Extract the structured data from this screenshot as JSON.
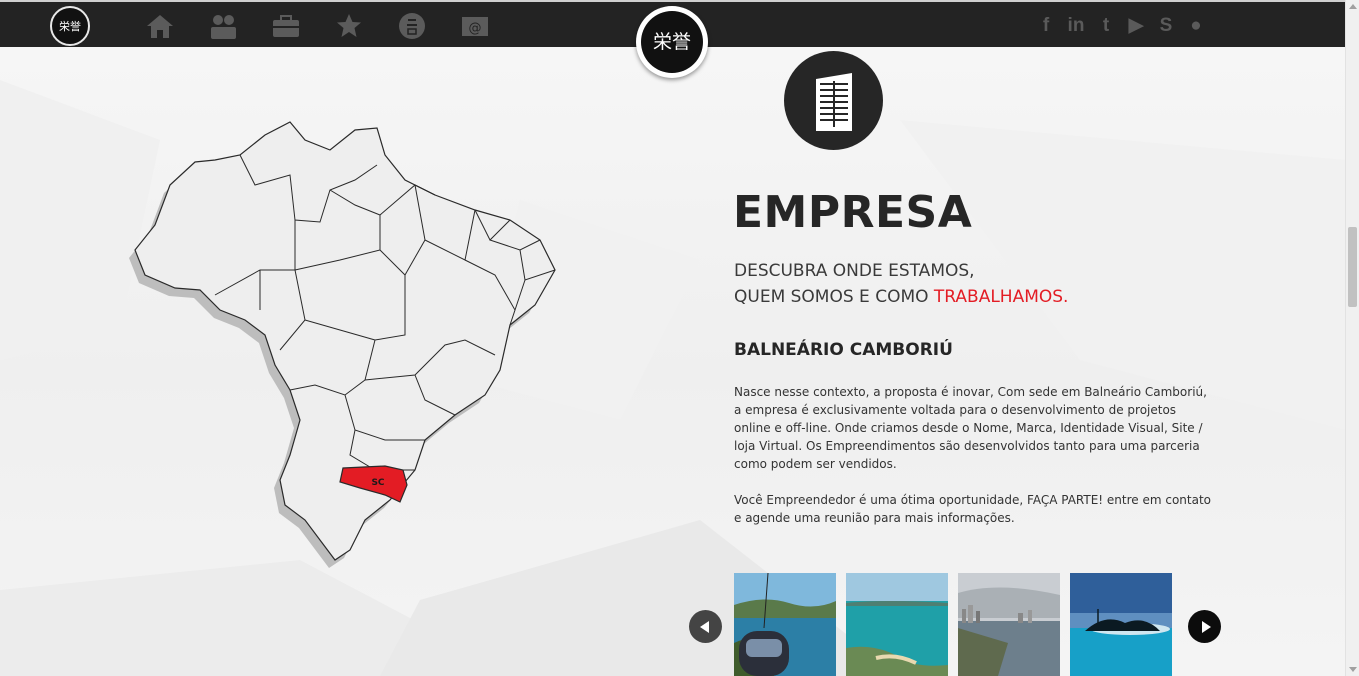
{
  "nav": {
    "logo_small_text": "栄誉",
    "items": [
      {
        "icon": "home-icon"
      },
      {
        "icon": "people-icon"
      },
      {
        "icon": "briefcase-icon"
      },
      {
        "icon": "star-icon"
      },
      {
        "icon": "kanji-badge-icon"
      },
      {
        "icon": "mail-icon"
      }
    ],
    "social": [
      {
        "icon": "facebook-icon",
        "glyph": "f"
      },
      {
        "icon": "linkedin-icon",
        "glyph": "in"
      },
      {
        "icon": "twitter-icon",
        "glyph": "t"
      },
      {
        "icon": "youtube-icon",
        "glyph": "▶"
      },
      {
        "icon": "skype-icon",
        "glyph": "S"
      },
      {
        "icon": "flickr-icon",
        "glyph": "●"
      }
    ],
    "logo_center_text": "栄誉"
  },
  "map": {
    "highlight_label": "SC",
    "highlight_color": "#e31c24"
  },
  "content": {
    "title": "EMPRESA",
    "subtitle_line1": "DESCUBRA ONDE ESTAMOS,",
    "subtitle_line2_prefix": "QUEM SOMOS E COMO ",
    "subtitle_line2_accent": "TRABALHAMOS.",
    "city": "BALNEÁRIO CAMBORIÚ",
    "paragraph1": "Nasce nesse contexto, a proposta é inovar, Com sede em Balneário Camboriú, a empresa é exclusivamente voltada para o desenvolvimento de projetos online e off-line. Onde criamos desde o Nome, Marca, Identidade Visual, Site / loja Virtual. Os Empreendimentos são desenvolvidos tanto para uma parceria como podem ser vendidos.",
    "paragraph2": "Você Empreendedor é uma ótima oportunidade, FAÇA PARTE! entre em contato e agende uma reunião para mais informações."
  },
  "carousel": {
    "prev_icon": "chevron-left-icon",
    "next_icon": "chevron-right-icon",
    "photos": [
      "cable-car-photo",
      "beach-aerial-photo",
      "coastline-city-photo",
      "island-sunset-photo"
    ]
  },
  "colors": {
    "accent": "#e31c24",
    "dark": "#262626",
    "topbar": "#232323"
  }
}
